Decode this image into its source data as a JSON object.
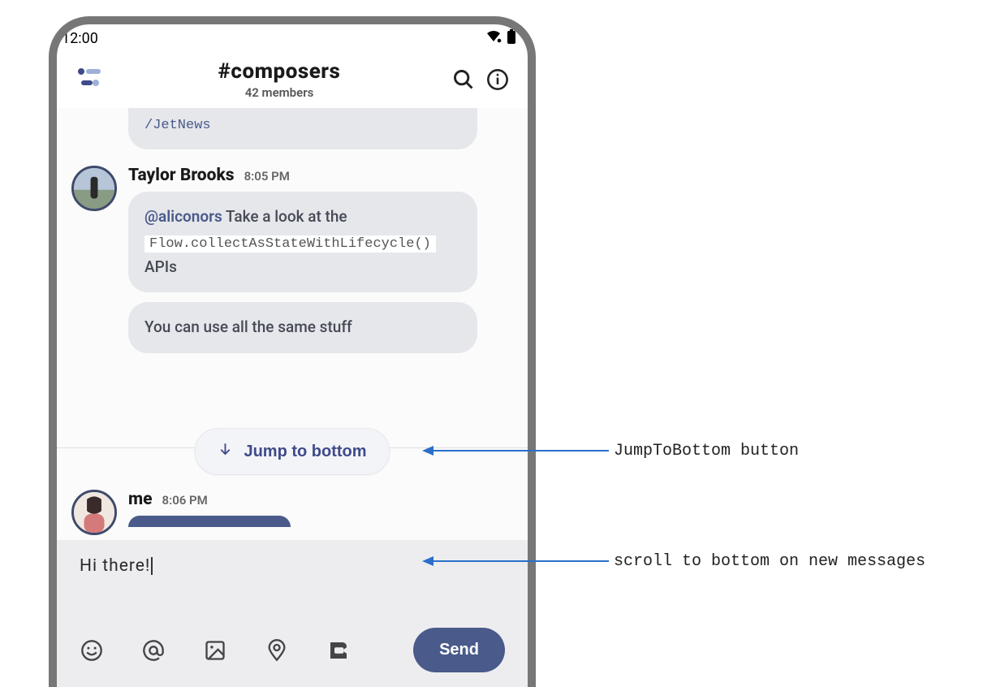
{
  "status": {
    "time": "12:00"
  },
  "header": {
    "channel": "#composers",
    "members": "42 members"
  },
  "messages": {
    "partial_bubble": "/JetNews",
    "taylor": {
      "author": "Taylor Brooks",
      "time": "8:05 PM",
      "bubble1_mention": "@aliconors",
      "bubble1_text_before_code": " Take a look at the ",
      "bubble1_code": "Flow.collectAsStateWithLifecycle()",
      "bubble1_text_after_code": " APIs",
      "bubble2": "You can use all the same stuff"
    },
    "me": {
      "author": "me",
      "time": "8:06 PM"
    }
  },
  "jump_button": "Jump to bottom",
  "composer": {
    "input_value": "Hi there!",
    "send_label": "Send"
  },
  "annotations": {
    "jump": "JumpToBottom button",
    "scroll": "scroll to bottom on new messages"
  }
}
